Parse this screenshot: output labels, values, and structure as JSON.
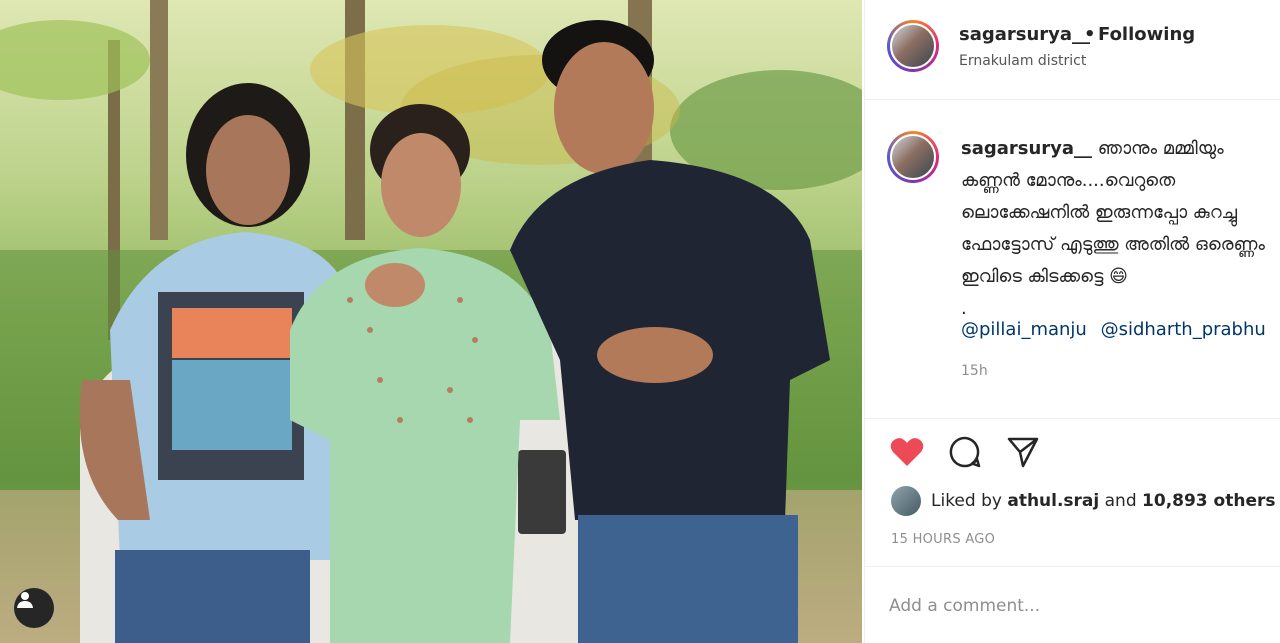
{
  "post": {
    "username": "sagarsurya__",
    "separator": "•",
    "follow_status": "Following",
    "location": "Ernakulam district"
  },
  "caption": {
    "username": "sagarsurya__",
    "text": "ഞാനും മമ്മിയും കണ്ണൻ മോനും....വെറുതെ ലൊക്കേഷനിൽ ഇരുന്നപ്പോ കുറച്ചു ഫോട്ടോസ് എടുത്തു അതിൽ ഒരെണ്ണം ഇവിടെ കിടക്കട്ടെ 😄\n.",
    "mentions": [
      "@pillai_manju",
      "@sidharth_prabhu"
    ],
    "age": "15h"
  },
  "actions": {
    "like_icon": "heart-filled-icon",
    "comment_icon": "comment-bubble-icon",
    "share_icon": "paper-plane-icon",
    "like_color": "#ed4956"
  },
  "likes": {
    "prefix": "Liked by ",
    "user": "athul.sraj",
    "middle": " and ",
    "count": "10,893 others"
  },
  "timestamp": "15 HOURS AGO",
  "comment_box": {
    "placeholder": "Add a comment..."
  },
  "photo": {
    "tag_icon": "user-tag-icon"
  }
}
